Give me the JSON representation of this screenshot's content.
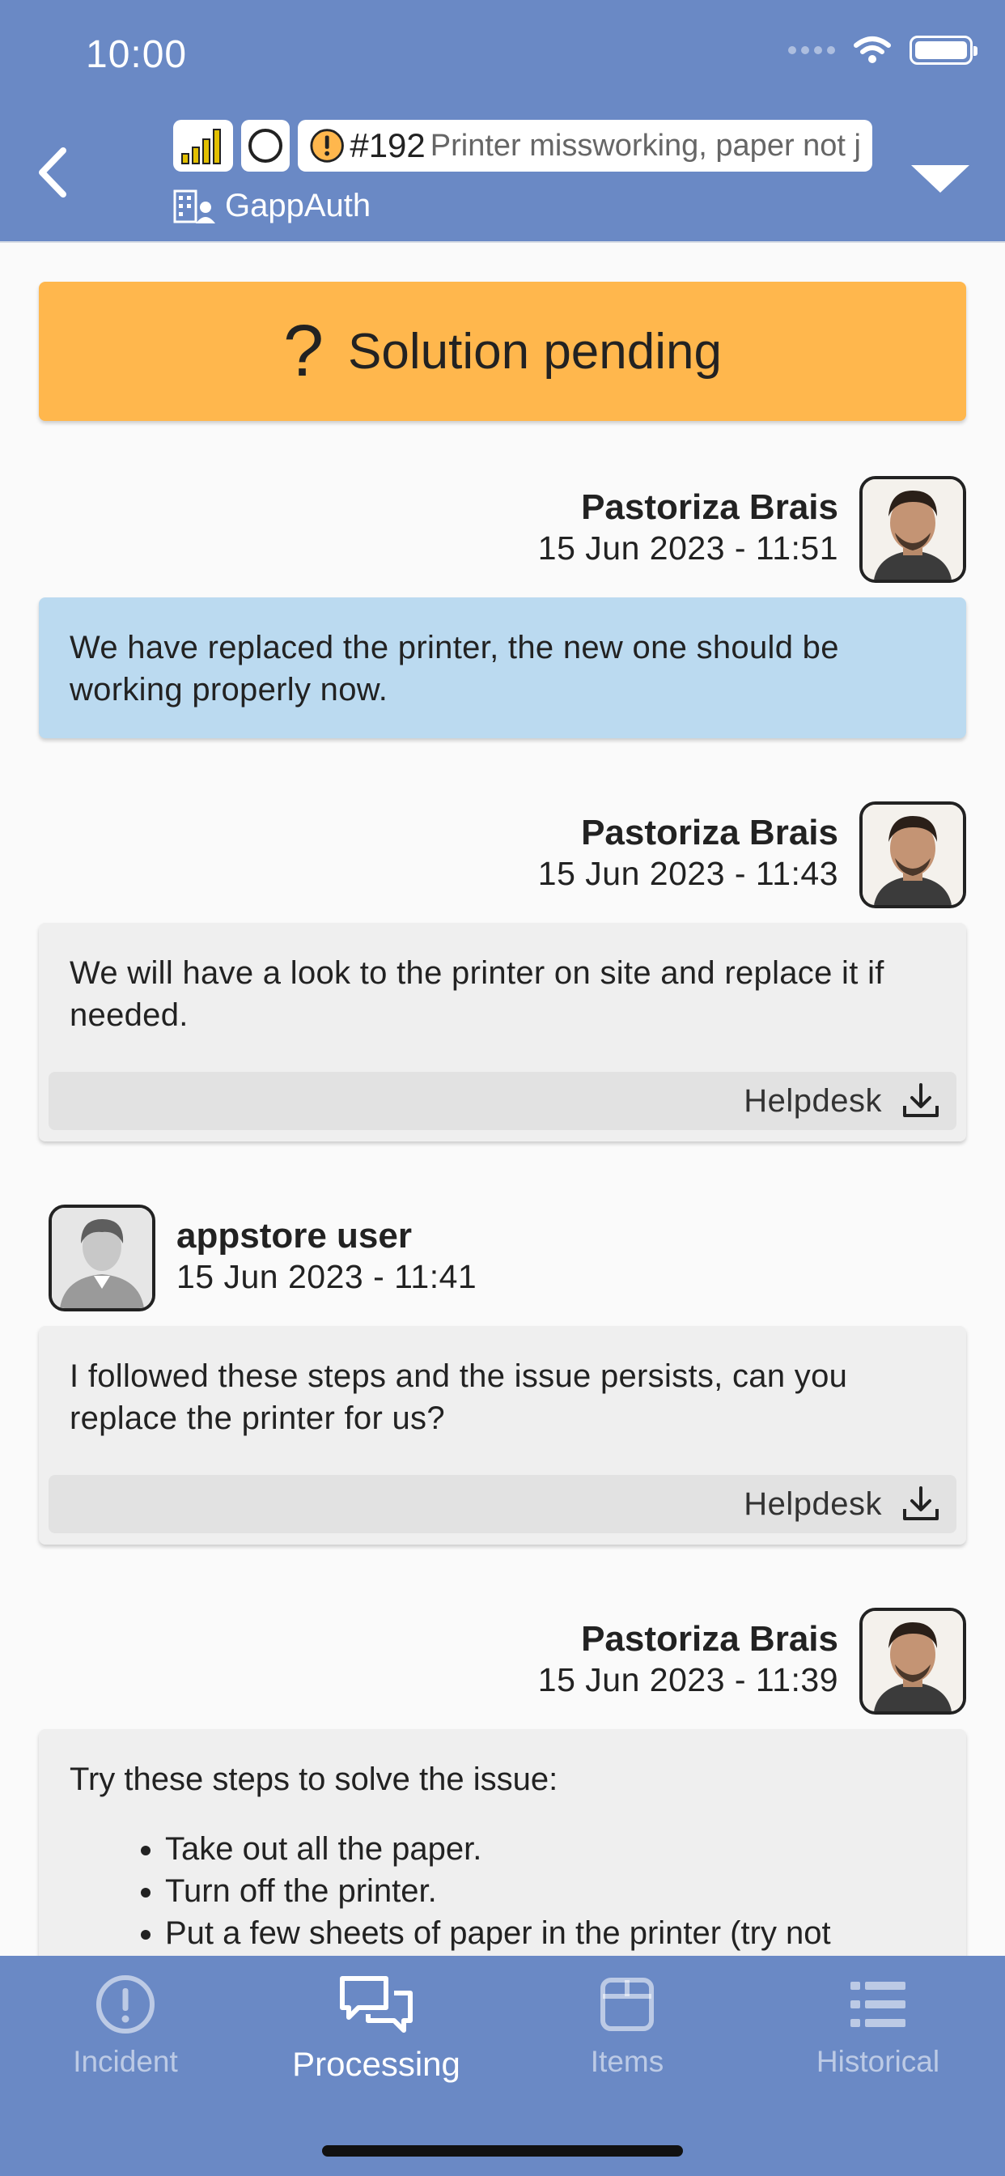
{
  "status_bar": {
    "time": "10:00"
  },
  "header": {
    "ticket_number": "#192",
    "ticket_title": "Printer missworking, paper not j",
    "company": "GappAuth"
  },
  "status_banner": {
    "label": "Solution pending",
    "color": "#ffb74d"
  },
  "messages": [
    {
      "author": "Pastoriza Brais",
      "date": "15 Jun 2023 - 11:51",
      "text": "We have replaced the printer, the new one should be working properly now."
    },
    {
      "author": "Pastoriza Brais",
      "date": "15 Jun 2023 - 11:43",
      "text": "We will have a look to the printer on site and replace it if needed.",
      "footer": "Helpdesk"
    },
    {
      "author": "appstore user",
      "date": "15 Jun 2023 - 11:41",
      "text": "I followed these steps and the issue persists, can you replace the printer for us?",
      "footer": "Helpdesk"
    },
    {
      "author": "Pastoriza Brais",
      "date": "15 Jun 2023 - 11:39",
      "text": "Try these steps to solve the issue:",
      "steps": [
        "Take out all the paper.",
        "Turn off the printer.",
        "Put a few sheets of paper in the printer (try not"
      ]
    }
  ],
  "tabs": [
    {
      "label": "Incident",
      "icon": "alert-circle-icon"
    },
    {
      "label": "Processing",
      "icon": "chat-bubbles-icon",
      "active": true
    },
    {
      "label": "Items",
      "icon": "box-icon"
    },
    {
      "label": "Historical",
      "icon": "list-icon"
    }
  ],
  "colors": {
    "header": "#6a89c5",
    "pending": "#ffb74d",
    "agent_bubble": "#bbdaf0",
    "bubble": "#efefef"
  }
}
